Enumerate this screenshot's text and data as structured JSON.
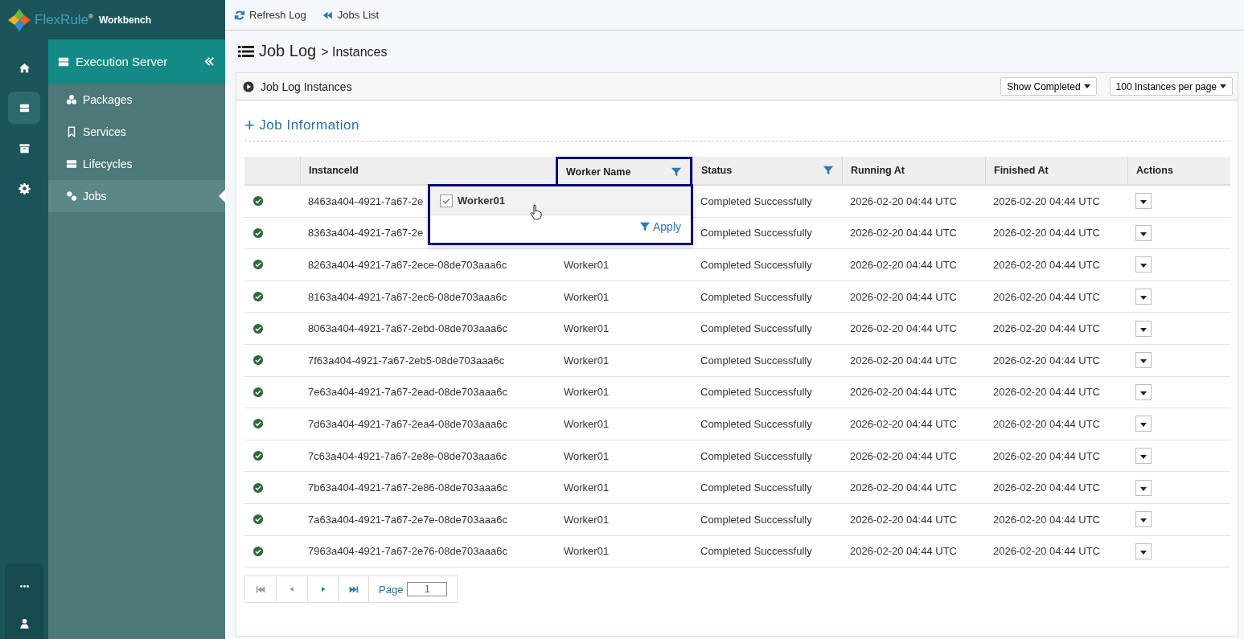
{
  "brand": {
    "name": "FlexRule",
    "sup": "®",
    "product": "Workbench"
  },
  "rail": {
    "top": [
      {
        "selected": false
      },
      {
        "selected": true
      },
      {
        "selected": false
      },
      {
        "selected": false
      }
    ],
    "bottom": [
      {
        "selected": false
      },
      {
        "selected": false
      }
    ]
  },
  "nav": {
    "header": "Execution Server",
    "items": [
      {
        "label": "Packages",
        "selected": false
      },
      {
        "label": "Services",
        "selected": false
      },
      {
        "label": "Lifecycles",
        "selected": false
      },
      {
        "label": "Jobs",
        "selected": true
      }
    ]
  },
  "toolbar": [
    {
      "label": "Refresh Log"
    },
    {
      "label": "Jobs List"
    }
  ],
  "page_title": {
    "main": "Job Log",
    "sub": "> Instances"
  },
  "panel": {
    "title": "Job Log Instances",
    "dropdowns": [
      "Show Completed",
      "100 Instances per page"
    ],
    "section": {
      "sign": "+",
      "label": "Job Information"
    }
  },
  "table": {
    "columns": [
      {
        "label": "InstanceId",
        "filter": false,
        "filter_open": false
      },
      {
        "label": "Worker Name",
        "filter": true,
        "filter_open": true
      },
      {
        "label": "Status",
        "filter": true,
        "filter_open": false
      },
      {
        "label": "Running At",
        "filter": false,
        "filter_open": false
      },
      {
        "label": "Finished At",
        "filter": false,
        "filter_open": false
      },
      {
        "label": "Actions",
        "filter": false,
        "filter_open": false
      }
    ],
    "rows": [
      {
        "id": "8463a404-4921-7a67-2e",
        "status": "Completed Successfully",
        "running": "2026-02-20 04:44 UTC",
        "finished": "2026-02-20 04:44 UTC"
      },
      {
        "id": "8363a404-4921-7a67-2e",
        "status": "Completed Successfully",
        "running": "2026-02-20 04:44 UTC",
        "finished": "2026-02-20 04:44 UTC"
      },
      {
        "id": "8263a404-4921-7a67-2ece-08de703aaa6c",
        "worker": "Worker01",
        "status": "Completed Successfully",
        "running": "2026-02-20 04:44 UTC",
        "finished": "2026-02-20 04:44 UTC"
      },
      {
        "id": "8163a404-4921-7a67-2ec6-08de703aaa6c",
        "worker": "Worker01",
        "status": "Completed Successfully",
        "running": "2026-02-20 04:44 UTC",
        "finished": "2026-02-20 04:44 UTC"
      },
      {
        "id": "8063a404-4921-7a67-2ebd-08de703aaa6c",
        "worker": "Worker01",
        "status": "Completed Successfully",
        "running": "2026-02-20 04:44 UTC",
        "finished": "2026-02-20 04:44 UTC"
      },
      {
        "id": "7f63a404-4921-7a67-2eb5-08de703aaa6c",
        "worker": "Worker01",
        "status": "Completed Successfully",
        "running": "2026-02-20 04:44 UTC",
        "finished": "2026-02-20 04:44 UTC"
      },
      {
        "id": "7e63a404-4921-7a67-2ead-08de703aaa6c",
        "worker": "Worker01",
        "status": "Completed Successfully",
        "running": "2026-02-20 04:44 UTC",
        "finished": "2026-02-20 04:44 UTC"
      },
      {
        "id": "7d63a404-4921-7a67-2ea4-08de703aaa6c",
        "worker": "Worker01",
        "status": "Completed Successfully",
        "running": "2026-02-20 04:44 UTC",
        "finished": "2026-02-20 04:44 UTC"
      },
      {
        "id": "7c63a404-4921-7a67-2e8e-08de703aaa6c",
        "worker": "Worker01",
        "status": "Completed Successfully",
        "running": "2026-02-20 04:44 UTC",
        "finished": "2026-02-20 04:44 UTC"
      },
      {
        "id": "7b63a404-4921-7a67-2e86-08de703aaa6c",
        "worker": "Worker01",
        "status": "Completed Successfully",
        "running": "2026-02-20 04:44 UTC",
        "finished": "2026-02-20 04:44 UTC"
      },
      {
        "id": "7a63a404-4921-7a67-2e7e-08de703aaa6c",
        "worker": "Worker01",
        "status": "Completed Successfully",
        "running": "2026-02-20 04:44 UTC",
        "finished": "2026-02-20 04:44 UTC"
      },
      {
        "id": "7963a404-4921-7a67-2e76-08de703aaa6c",
        "worker": "Worker01",
        "status": "Completed Successfully",
        "running": "2026-02-20 04:44 UTC",
        "finished": "2026-02-20 04:44 UTC"
      }
    ]
  },
  "filter_popup": {
    "options": [
      {
        "label": "Worker01",
        "checked": true
      }
    ],
    "apply": "Apply"
  },
  "pager": {
    "label": "Page",
    "value": "1",
    "first_disabled": true,
    "prev_disabled": true
  }
}
